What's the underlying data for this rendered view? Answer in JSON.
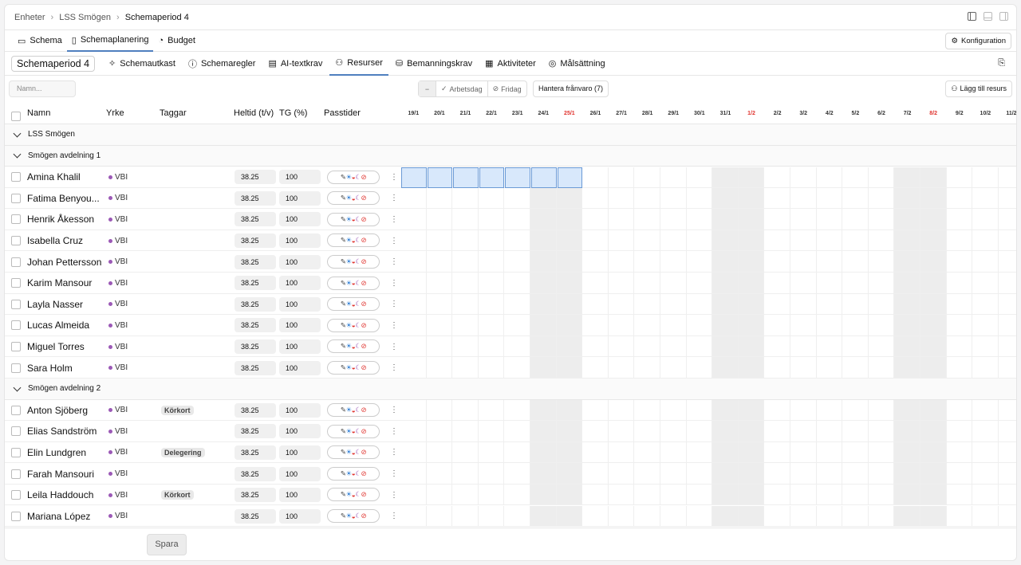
{
  "breadcrumb": [
    "Enheter",
    "LSS Smögen",
    "Schemaperiod 4"
  ],
  "nav1": {
    "tabs": [
      {
        "label": "Schema",
        "icon": "calendar-icon"
      },
      {
        "label": "Schemaplanering",
        "icon": "clipboard-icon",
        "active": true
      },
      {
        "label": "Budget",
        "icon": "pie-icon"
      }
    ],
    "config_label": "Konfiguration"
  },
  "nav2": {
    "period": "Schemaperiod 4",
    "tabs": [
      {
        "label": "Schemautkast",
        "icon": "sparkle-icon"
      },
      {
        "label": "Schemaregler",
        "icon": "info-icon"
      },
      {
        "label": "AI-textkrav",
        "icon": "document-icon"
      },
      {
        "label": "Resurser",
        "icon": "people-icon",
        "active": true
      },
      {
        "label": "Bemanningskrav",
        "icon": "database-icon"
      },
      {
        "label": "Aktiviteter",
        "icon": "grid-icon"
      },
      {
        "label": "Målsättning",
        "icon": "target-icon"
      }
    ]
  },
  "toolbar": {
    "search_placeholder": "Namn...",
    "seg_minus": "−",
    "seg_arbetsdag": "Arbetsdag",
    "seg_fridag": "Fridag",
    "hantera": "Hantera frånvaro (7)",
    "lagg_till": "Lägg till resurs"
  },
  "columns": {
    "namn": "Namn",
    "yrke": "Yrke",
    "taggar": "Taggar",
    "heltid": "Heltid (t/v)",
    "tg": "TG (%)",
    "passtider": "Passtider"
  },
  "dates": [
    {
      "d": "19/1"
    },
    {
      "d": "20/1"
    },
    {
      "d": "21/1"
    },
    {
      "d": "22/1"
    },
    {
      "d": "23/1"
    },
    {
      "d": "24/1"
    },
    {
      "d": "25/1",
      "red": true
    },
    {
      "d": "26/1"
    },
    {
      "d": "27/1"
    },
    {
      "d": "28/1"
    },
    {
      "d": "29/1"
    },
    {
      "d": "30/1"
    },
    {
      "d": "31/1"
    },
    {
      "d": "1/2",
      "red": true
    },
    {
      "d": "2/2"
    },
    {
      "d": "3/2"
    },
    {
      "d": "4/2"
    },
    {
      "d": "5/2"
    },
    {
      "d": "6/2"
    },
    {
      "d": "7/2"
    },
    {
      "d": "8/2",
      "red": true
    },
    {
      "d": "9/2"
    },
    {
      "d": "10/2"
    },
    {
      "d": "11/2"
    }
  ],
  "unit": "LSS Smögen",
  "groups": [
    {
      "name": "Smögen avdelning 1",
      "people": [
        {
          "name": "Amina Khalil",
          "yrke": "VBI",
          "tag": "",
          "heltid": "38.25",
          "tg": "100"
        },
        {
          "name": "Fatima Benyou...",
          "yrke": "VBI",
          "tag": "",
          "heltid": "38.25",
          "tg": "100"
        },
        {
          "name": "Henrik Åkesson",
          "yrke": "VBI",
          "tag": "",
          "heltid": "38.25",
          "tg": "100"
        },
        {
          "name": "Isabella Cruz",
          "yrke": "VBI",
          "tag": "",
          "heltid": "38.25",
          "tg": "100"
        },
        {
          "name": "Johan Pettersson",
          "yrke": "VBI",
          "tag": "",
          "heltid": "38.25",
          "tg": "100"
        },
        {
          "name": "Karim Mansour",
          "yrke": "VBI",
          "tag": "",
          "heltid": "38.25",
          "tg": "100"
        },
        {
          "name": "Layla Nasser",
          "yrke": "VBI",
          "tag": "",
          "heltid": "38.25",
          "tg": "100"
        },
        {
          "name": "Lucas Almeida",
          "yrke": "VBI",
          "tag": "",
          "heltid": "38.25",
          "tg": "100"
        },
        {
          "name": "Miguel Torres",
          "yrke": "VBI",
          "tag": "",
          "heltid": "38.25",
          "tg": "100"
        },
        {
          "name": "Sara Holm",
          "yrke": "VBI",
          "tag": "",
          "heltid": "38.25",
          "tg": "100"
        }
      ]
    },
    {
      "name": "Smögen avdelning 2",
      "people": [
        {
          "name": "Anton Sjöberg",
          "yrke": "VBI",
          "tag": "Körkort",
          "heltid": "38.25",
          "tg": "100"
        },
        {
          "name": "Elias Sandström",
          "yrke": "VBI",
          "tag": "",
          "heltid": "38.25",
          "tg": "100"
        },
        {
          "name": "Elin Lundgren",
          "yrke": "VBI",
          "tag": "Delegering",
          "heltid": "38.25",
          "tg": "100"
        },
        {
          "name": "Farah Mansouri",
          "yrke": "VBI",
          "tag": "",
          "heltid": "38.25",
          "tg": "100"
        },
        {
          "name": "Leila Haddouch",
          "yrke": "VBI",
          "tag": "Körkort",
          "heltid": "38.25",
          "tg": "100"
        },
        {
          "name": "Mariana López",
          "yrke": "VBI",
          "tag": "",
          "heltid": "38.25",
          "tg": "100"
        }
      ]
    }
  ],
  "save_label": "Spara",
  "colors": {
    "accent": "#4f7fbf",
    "red": "#e0342f",
    "selected": "#d8e8fb"
  }
}
